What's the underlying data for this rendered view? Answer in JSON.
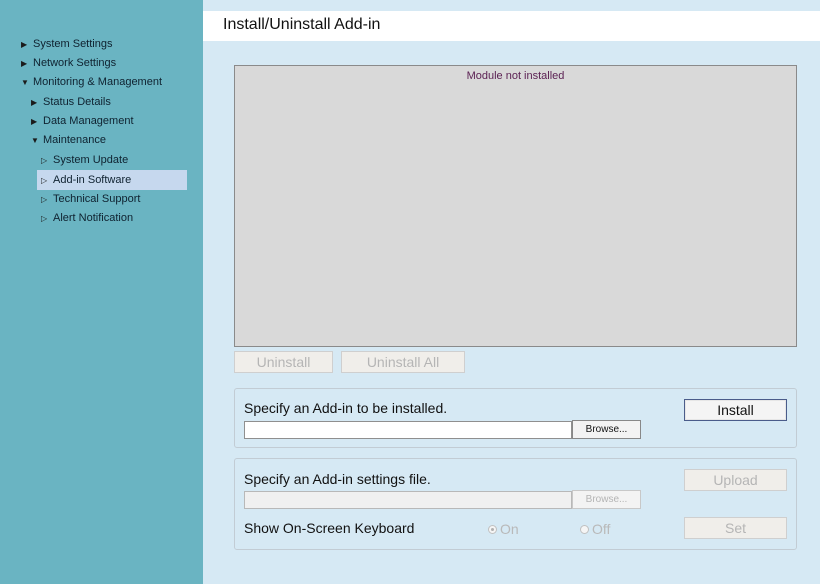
{
  "sidebar": {
    "items": [
      {
        "label": "System Settings",
        "arrow": "right"
      },
      {
        "label": "Network Settings",
        "arrow": "right"
      },
      {
        "label": "Monitoring & Management",
        "arrow": "down"
      },
      {
        "label": "Status Details",
        "arrow": "right"
      },
      {
        "label": "Data Management",
        "arrow": "right"
      },
      {
        "label": "Maintenance",
        "arrow": "down"
      },
      {
        "label": "System Update",
        "arrow": "right-outline"
      },
      {
        "label": "Add-in Software",
        "arrow": "right-outline",
        "selected": true
      },
      {
        "label": "Technical Support",
        "arrow": "right-outline"
      },
      {
        "label": "Alert Notification",
        "arrow": "right-outline"
      }
    ]
  },
  "main": {
    "title": "Install/Uninstall Add-in",
    "module_status": "Module not installed",
    "uninstall_label": "Uninstall",
    "uninstall_all_label": "Uninstall All",
    "install_panel": {
      "label": "Specify an Add-in to be installed.",
      "file_value": "",
      "browse_label": "Browse...",
      "install_label": "Install"
    },
    "settings_panel": {
      "label": "Specify an Add-in settings file.",
      "file_value": "",
      "browse_label": "Browse...",
      "upload_label": "Upload",
      "keyboard_label": "Show On-Screen Keyboard",
      "on_label": "On",
      "off_label": "Off",
      "keyboard_selected": "On",
      "set_label": "Set"
    }
  },
  "colors": {
    "sidebar_bg": "#6ab4c2",
    "main_bg": "#d6e9f4",
    "selected_bg": "#c6d8ee",
    "module_box_bg": "#d9d9d9"
  }
}
